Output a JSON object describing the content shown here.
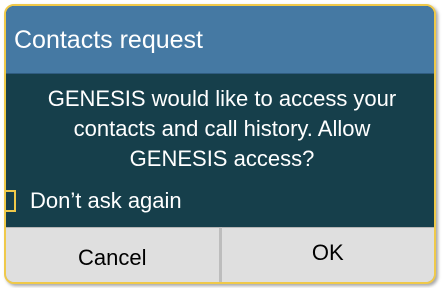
{
  "dialog": {
    "title": "Contacts request",
    "message_lines": [
      "GENESIS would like to access your",
      "contacts and call history. Allow",
      "GENESIS access?"
    ],
    "checkbox": {
      "label": "Don’t ask again",
      "checked": false
    },
    "buttons": {
      "cancel_label": "Cancel",
      "ok_label": "OK"
    }
  },
  "colors": {
    "header_bg": "#4579a3",
    "body_bg": "#163f4b",
    "border_accent": "#efc94a",
    "button_bg": "#dfdfdf"
  }
}
